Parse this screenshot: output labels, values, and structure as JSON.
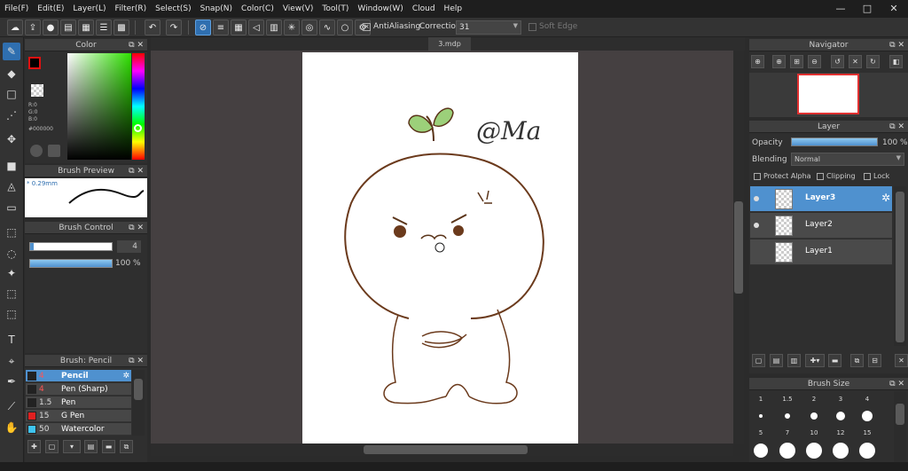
{
  "menu": [
    "File(F)",
    "Edit(E)",
    "Layer(L)",
    "Filter(R)",
    "Select(S)",
    "Snap(N)",
    "Color(C)",
    "View(V)",
    "Tool(T)",
    "Window(W)",
    "Cloud",
    "Help"
  ],
  "toolbar": {
    "antialiasing_label": "AntiAliasing",
    "correction_label": "Correction",
    "correction_value": "31",
    "soft_edge_label": "Soft Edge"
  },
  "color_panel": {
    "title": "Color",
    "r": "R:0",
    "g": "G:0",
    "b": "B:0",
    "hex": "#000000",
    "primary": "#000000",
    "secondary": "#ffffff"
  },
  "brush_preview": {
    "title": "Brush Preview",
    "size": "* 0.29mm"
  },
  "brush_control": {
    "title": "Brush Control",
    "size_value": "4",
    "opacity_value": "100 %"
  },
  "brush_list": {
    "title": "Brush: Pencil",
    "items": [
      {
        "size": "4",
        "name": "Pencil",
        "color": "#222222",
        "selected": true
      },
      {
        "size": "4",
        "name": "Pen (Sharp)",
        "color": "#222222",
        "selected": false
      },
      {
        "size": "1.5",
        "name": "Pen",
        "color": "#222222",
        "selected": false
      },
      {
        "size": "15",
        "name": "G Pen",
        "color": "#e02020",
        "selected": false
      },
      {
        "size": "50",
        "name": "Watercolor",
        "color": "#3fc4f0",
        "selected": false
      }
    ]
  },
  "document": {
    "tab": "3.mdp",
    "drawing_text": "@Ma"
  },
  "navigator": {
    "title": "Navigator"
  },
  "layer_panel": {
    "title": "Layer",
    "opacity_label": "Opacity",
    "opacity_value": "100 %",
    "blending_label": "Blending",
    "blending_value": "Normal",
    "protect_alpha": "Protect Alpha",
    "clipping": "Clipping",
    "lock": "Lock",
    "layers": [
      {
        "name": "Layer3",
        "selected": true,
        "visible": true
      },
      {
        "name": "Layer2",
        "selected": false,
        "visible": true
      },
      {
        "name": "Layer1",
        "selected": false,
        "visible": false
      }
    ]
  },
  "brush_size": {
    "title": "Brush Size",
    "row1": [
      "1",
      "1.5",
      "2",
      "3",
      "4"
    ],
    "row2": [
      "5",
      "7",
      "10",
      "12",
      "15"
    ]
  }
}
